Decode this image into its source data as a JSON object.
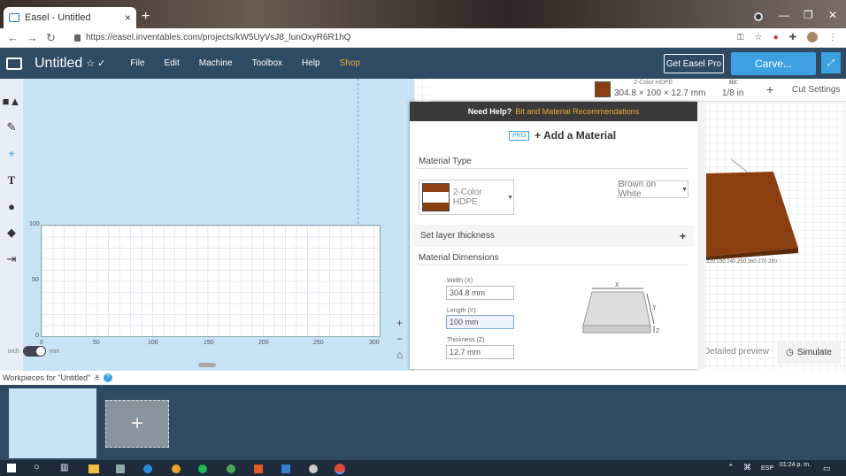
{
  "browser": {
    "tab_title": "Easel - Untitled",
    "url": "https://easel.inventables.com/projects/kW5UyVsJ8_lunOxyR6R1hQ",
    "new_tab_symbol": "+",
    "tab_close_symbol": "×"
  },
  "app": {
    "project_title": "Untitled",
    "menu": [
      "File",
      "Edit",
      "Machine",
      "Toolbox",
      "Help",
      "Shop"
    ],
    "get_pro_label": "Get Easel Pro",
    "carve_label": "Carve..."
  },
  "canvas": {
    "y_ticks": [
      "100",
      "50",
      "0"
    ],
    "x_ticks": [
      "0",
      "50",
      "100",
      "150",
      "200",
      "250",
      "300"
    ],
    "unit_left": "inch",
    "unit_right": "mm",
    "zoom_in": "+",
    "zoom_out": "−"
  },
  "preview": {
    "material_name": "2-Color HDPE",
    "material_dims": "304.8 × 100 × 12.7 mm",
    "bit_label": "Bit:",
    "bit_value": "1/8 in",
    "cut_settings_label": "Cut Settings",
    "axis_numbers": "220 230 240 250 260 270 280",
    "detailed_preview_label": "Detailed preview",
    "simulate_label": "Simulate"
  },
  "material_modal": {
    "help_prefix": "Need Help?",
    "help_link": "Bit and Material Recommendations",
    "pro_badge": "PRO",
    "title": "+ Add a Material",
    "material_type_label": "Material Type",
    "material_type_value": "2-Color HDPE",
    "color_value": "Brown on White",
    "layer_thickness_label": "Set layer thickness",
    "dimensions_label": "Material Dimensions",
    "width_label": "Width (X)",
    "width_value": "304.8 mm",
    "length_label": "Length (Y)",
    "length_value": "100 mm",
    "thickness_label": "Thickness (Z)",
    "thickness_value": "12.7 mm",
    "diagram_x": "X",
    "diagram_y": "Y",
    "diagram_z": "Z"
  },
  "workpieces": {
    "label": "Workpieces for \"Untitled\"",
    "help_symbol": "?"
  },
  "taskbar": {
    "time": "01:24 p. m.",
    "language": "ESP"
  },
  "colors": {
    "header": "#2f4a63",
    "accent": "#3da0e0",
    "shop": "#f0a732",
    "material_brown": "#8b3f10",
    "workpiece_bg": "#2f4a63"
  }
}
